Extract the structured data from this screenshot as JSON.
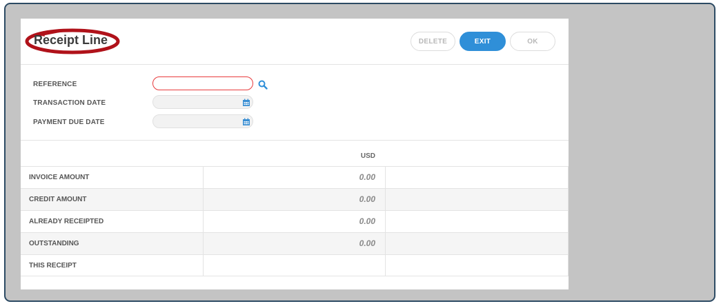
{
  "header": {
    "title": "Receipt Line",
    "buttons": {
      "delete": "DELETE",
      "exit": "EXIT",
      "ok": "OK"
    }
  },
  "form": {
    "reference_label": "REFERENCE",
    "reference_value": "",
    "transaction_date_label": "TRANSACTION DATE",
    "transaction_date_value": "",
    "payment_due_date_label": "PAYMENT DUE DATE",
    "payment_due_date_value": ""
  },
  "table": {
    "currency": "USD",
    "rows": [
      {
        "label": "INVOICE AMOUNT",
        "value": "0.00"
      },
      {
        "label": "CREDIT AMOUNT",
        "value": "0.00"
      },
      {
        "label": "ALREADY RECEIPTED",
        "value": "0.00"
      },
      {
        "label": "OUTSTANDING",
        "value": "0.00"
      },
      {
        "label": "THIS RECEIPT",
        "value": ""
      }
    ]
  },
  "colors": {
    "accent": "#2f8fd8",
    "error_border": "#e8393b",
    "annotation": "#b0121a",
    "frame_border": "#2c4a63",
    "backdrop": "#c4c4c4"
  },
  "icons": {
    "search": "search-icon",
    "calendar": "calendar-icon",
    "annotation": "annotation-oval-icon"
  }
}
